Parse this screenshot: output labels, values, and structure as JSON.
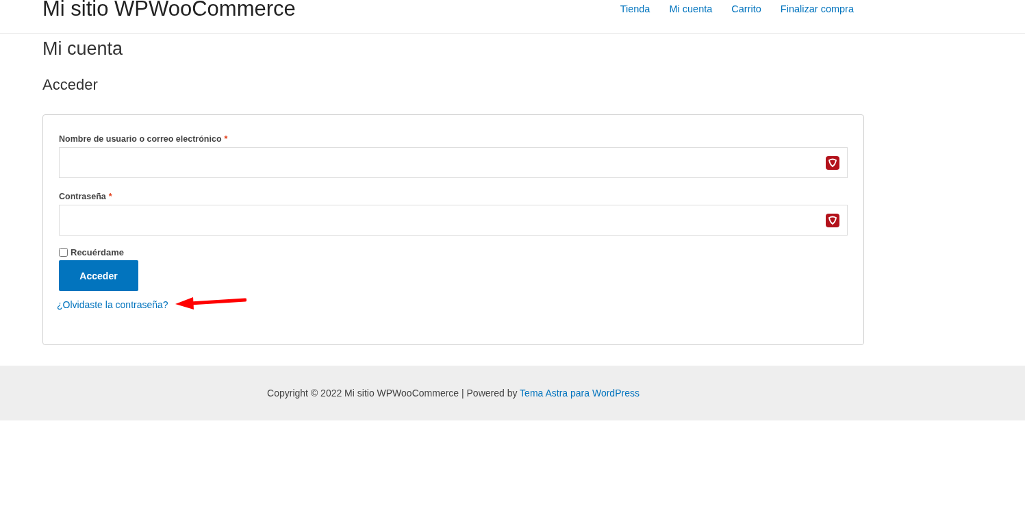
{
  "header": {
    "site_title": "Mi sitio WPWooCommerce",
    "nav": [
      {
        "label": "Tienda"
      },
      {
        "label": "Mi cuenta"
      },
      {
        "label": "Carrito"
      },
      {
        "label": "Finalizar compra"
      }
    ]
  },
  "page_title": "Mi cuenta",
  "section_title": "Acceder",
  "form": {
    "fields": [
      {
        "label": "Nombre de usuario o correo electrónico",
        "required_mark": "*"
      },
      {
        "label": "Contraseña",
        "required_mark": "*"
      }
    ],
    "remember": {
      "label": "Recuérdame",
      "checked": false
    },
    "submit": "Acceder",
    "lost_password": "¿Olvidaste la contraseña?"
  },
  "footer": {
    "text": "Copyright © 2022 Mi sitio WPWooCommerce | Powered by ",
    "link": "Tema Astra para WordPress"
  }
}
